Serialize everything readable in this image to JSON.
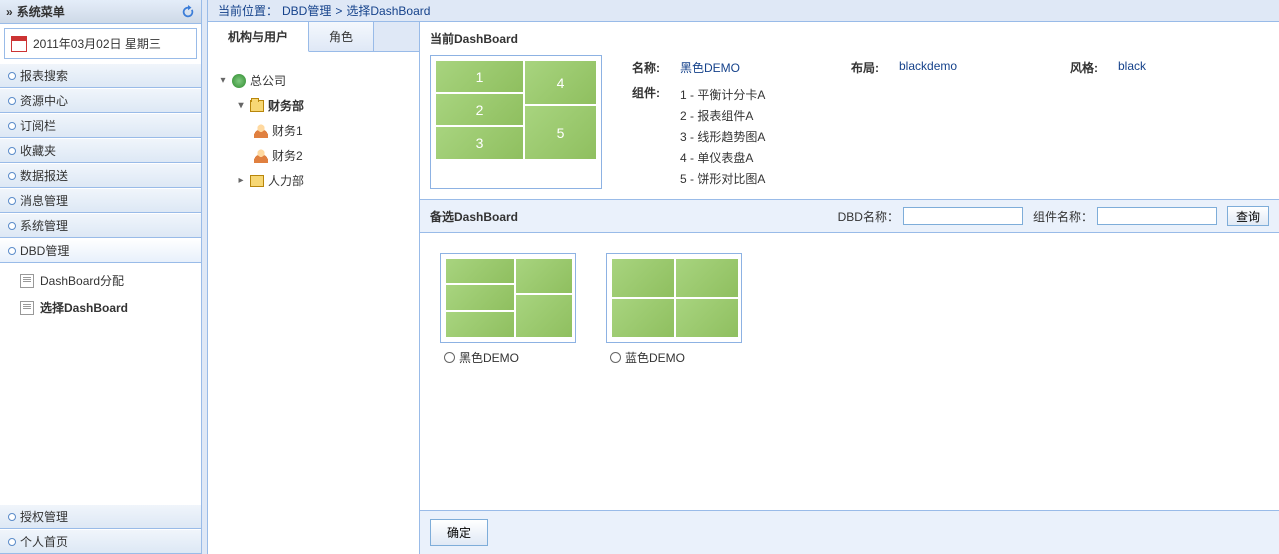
{
  "sidebar": {
    "title": "系统菜单",
    "date": "2011年03月02日 星期三",
    "menu": [
      {
        "label": "报表搜索"
      },
      {
        "label": "资源中心"
      },
      {
        "label": "订阅栏"
      },
      {
        "label": "收藏夹"
      },
      {
        "label": "数据报送"
      },
      {
        "label": "消息管理"
      },
      {
        "label": "系统管理"
      },
      {
        "label": "DBD管理",
        "expanded": true,
        "children": [
          {
            "label": "DashBoard分配"
          },
          {
            "label": "选择DashBoard",
            "selected": true
          }
        ]
      },
      {
        "label": "授权管理"
      },
      {
        "label": "个人首页"
      }
    ]
  },
  "breadcrumb": {
    "prefix": "当前位置：",
    "parts": [
      "DBD管理",
      "选择DashBoard"
    ]
  },
  "tabs": [
    {
      "label": "机构与用户",
      "active": true
    },
    {
      "label": "角色"
    }
  ],
  "tree": {
    "root": "总公司",
    "nodes": [
      {
        "label": "财务部",
        "expanded": true,
        "bold": true,
        "children": [
          {
            "label": "财务1"
          },
          {
            "label": "财务2"
          }
        ]
      },
      {
        "label": "人力部"
      }
    ]
  },
  "current": {
    "title": "当前DashBoard",
    "name_label": "名称:",
    "name_value": "黑色DEMO",
    "layout_label": "布局:",
    "layout_value": "blackdemo",
    "style_label": "风格:",
    "style_value": "black",
    "components_label": "组件:",
    "components": [
      "1 - 平衡计分卡A",
      "2 - 报表组件A",
      "3 - 线形趋势图A",
      "4 - 单仪表盘A",
      "5 - 饼形对比图A"
    ]
  },
  "backup": {
    "title": "备选DashBoard",
    "dbd_label": "DBD名称：",
    "component_label": "组件名称：",
    "search_btn": "查询",
    "items": [
      {
        "label": "黑色DEMO"
      },
      {
        "label": "蓝色DEMO"
      }
    ]
  },
  "footer": {
    "confirm": "确定"
  }
}
